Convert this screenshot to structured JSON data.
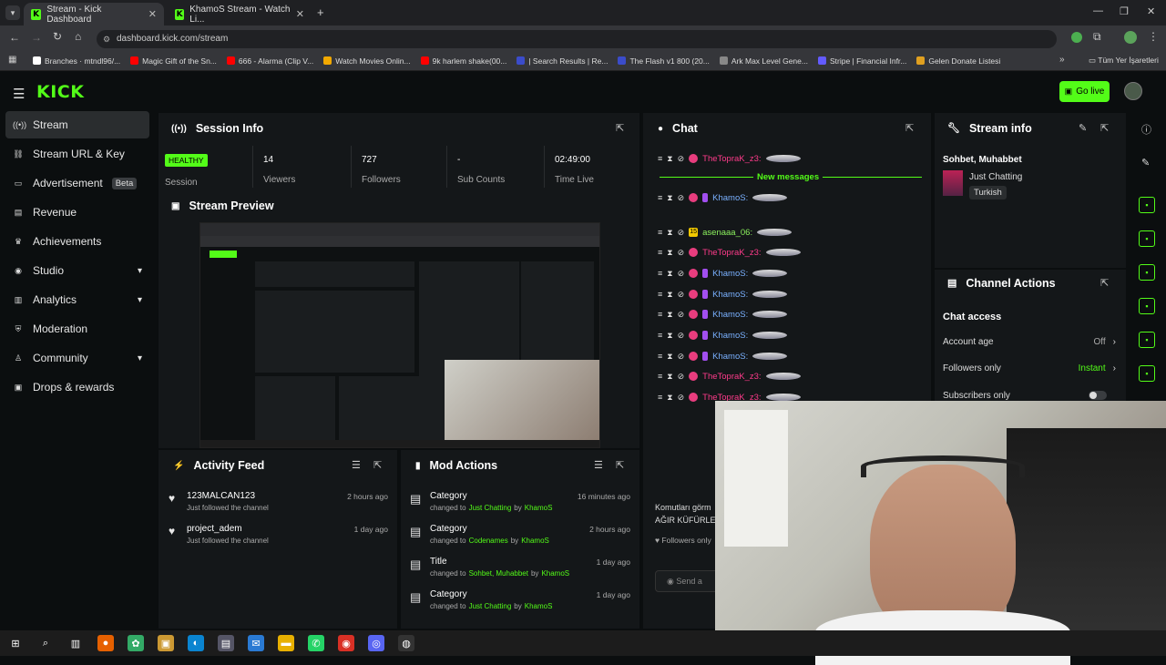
{
  "browser": {
    "tabs": [
      {
        "title": "Stream - Kick Dashboard"
      },
      {
        "title": "KhamoS Stream - Watch Li..."
      }
    ],
    "url": "dashboard.kick.com/stream",
    "bookmarks": [
      {
        "label": "Branches · mtndl96/...",
        "color": "#ffffff"
      },
      {
        "label": "Magic Gift of the Sn...",
        "color": "#ff0000"
      },
      {
        "label": "666 - Alarma (Clip V...",
        "color": "#ff0000"
      },
      {
        "label": "Watch Movies Onlin...",
        "color": "#f2a900"
      },
      {
        "label": "9k harlem shake(00...",
        "color": "#ff0000"
      },
      {
        "label": "| Search Results | Re...",
        "color": "#3b4cca"
      },
      {
        "label": "The Flash v1 800 (20...",
        "color": "#3b4cca"
      },
      {
        "label": "Ark Max Level Gene...",
        "color": "#888888"
      },
      {
        "label": "Stripe | Financial Infr...",
        "color": "#635bff"
      },
      {
        "label": "Gelen Donate Listesi",
        "color": "#e0a020"
      }
    ],
    "all_bookmarks": "Tüm Yer İşaretleri"
  },
  "header": {
    "logo": "KICK",
    "go_live": "Go live"
  },
  "sidebar": {
    "items": [
      {
        "label": "Stream",
        "icon": "broadcast-icon"
      },
      {
        "label": "Stream URL & Key",
        "icon": "link-icon"
      },
      {
        "label": "Advertisement",
        "icon": "ad-icon",
        "badge": "Beta"
      },
      {
        "label": "Revenue",
        "icon": "revenue-icon"
      },
      {
        "label": "Achievements",
        "icon": "achievement-icon"
      },
      {
        "label": "Studio",
        "icon": "studio-icon"
      },
      {
        "label": "Analytics",
        "icon": "analytics-icon"
      },
      {
        "label": "Moderation",
        "icon": "moderation-icon"
      },
      {
        "label": "Community",
        "icon": "community-icon"
      },
      {
        "label": "Drops & rewards",
        "icon": "drops-icon"
      }
    ]
  },
  "session": {
    "title": "Session Info",
    "status": "HEALTHY",
    "status_label": "Session",
    "stats": [
      {
        "value": "14",
        "label": "Viewers"
      },
      {
        "value": "727",
        "label": "Followers"
      },
      {
        "value": "-",
        "label": "Sub Counts"
      },
      {
        "value": "02:49:00",
        "label": "Time Live"
      }
    ]
  },
  "preview": {
    "title": "Stream Preview"
  },
  "activity": {
    "title": "Activity Feed",
    "items": [
      {
        "name": "123MALCAN123",
        "sub": "Just followed the channel",
        "time": "2 hours ago"
      },
      {
        "name": "project_adem",
        "sub": "Just followed the channel",
        "time": "1 day ago"
      }
    ]
  },
  "mod": {
    "title": "Mod Actions",
    "items": [
      {
        "title": "Category",
        "prefix": "changed to",
        "value": "Just Chatting",
        "by": "by",
        "user": "KhamoS",
        "time": "16 minutes ago"
      },
      {
        "title": "Category",
        "prefix": "changed to",
        "value": "Codenames",
        "by": "by",
        "user": "KhamoS",
        "time": "2 hours ago"
      },
      {
        "title": "Title",
        "prefix": "changed to",
        "value": "Sohbet, Muhabbet",
        "by": "by",
        "user": "KhamoS",
        "time": "1 day ago"
      },
      {
        "title": "Category",
        "prefix": "changed to",
        "value": "Just Chatting",
        "by": "by",
        "user": "KhamoS",
        "time": "1 day ago"
      }
    ]
  },
  "chat": {
    "title": "Chat",
    "new_messages": "New messages",
    "messages": [
      {
        "user": "TheTopraK_z3:",
        "color": "pink"
      },
      {
        "user": "KhamoS:",
        "color": "blue"
      },
      {
        "user": "asenaaa_06:",
        "color": "green"
      },
      {
        "user": "TheTopraK_z3:",
        "color": "pink"
      },
      {
        "user": "KhamoS:",
        "color": "blue"
      },
      {
        "user": "KhamoS:",
        "color": "blue"
      },
      {
        "user": "KhamoS:",
        "color": "blue"
      },
      {
        "user": "KhamoS:",
        "color": "blue"
      },
      {
        "user": "KhamoS:",
        "color": "blue"
      },
      {
        "user": "TheTopraK_z3:",
        "color": "pink"
      },
      {
        "user": "TheTopraK_z3:",
        "color": "pink"
      }
    ],
    "badge_15": "15",
    "note_1": "Komutları görm",
    "note_2": "AĞIR KÜFÜRLE",
    "followers_only": "Followers only",
    "send_placeholder": "Send a"
  },
  "stream_info": {
    "title": "Stream info",
    "stream_title": "Sohbet, Muhabbet",
    "category": "Just Chatting",
    "tag": "Turkish"
  },
  "channel_actions": {
    "title": "Channel Actions",
    "section": "Chat access",
    "rows": [
      {
        "label": "Account age",
        "value": "Off"
      },
      {
        "label": "Followers only",
        "value": "Instant"
      },
      {
        "label": "Subscribers only",
        "value": ""
      }
    ]
  },
  "colors": {
    "accent": "#53fc18",
    "panel": "#141719",
    "bg": "#0b0e0f"
  }
}
